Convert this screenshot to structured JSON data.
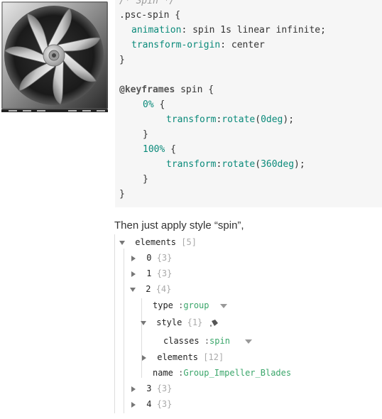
{
  "code": {
    "comment": "/* Spin */",
    "selector": ".psc-spin {",
    "anim_prop": "animation",
    "anim_val": " spin 1s linear infinite;",
    "origin_prop": "transform-origin",
    "origin_val": " center",
    "close1": "}",
    "keyframes_kw": "@keyframes",
    "keyframes_name": " spin {",
    "from_pct": "0%",
    "brace_open": " {",
    "transform_prop": "transform",
    "rotate_fn": "rotate",
    "from_deg": "0deg",
    "close_inner": "}",
    "to_pct": "100%",
    "to_deg": "360deg",
    "close_outer": "}"
  },
  "caption": "Then just apply style “spin”,",
  "tree": {
    "root_key": "elements",
    "root_count": "[5]",
    "items": [
      {
        "key": "0",
        "count": "{3}"
      },
      {
        "key": "1",
        "count": "{3}"
      },
      {
        "key": "2",
        "count": "{4}"
      },
      {
        "key": "3",
        "count": "{3}"
      },
      {
        "key": "4",
        "count": "{3}"
      }
    ],
    "type_key": "type",
    "type_val": "group",
    "style_key": "style",
    "style_count": "{1}",
    "classes_key": "classes",
    "classes_val": "spin",
    "elements_key": "elements",
    "elements_count": "[12]",
    "name_key": "name",
    "name_val": "Group_Impeller_Blades"
  }
}
